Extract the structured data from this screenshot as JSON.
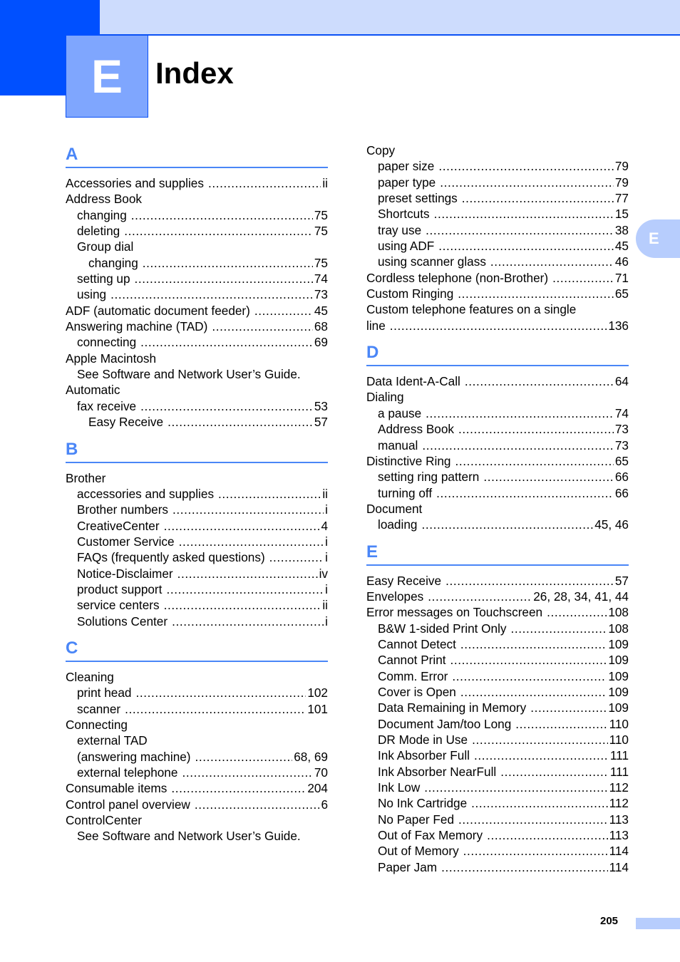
{
  "header": {
    "chapter_letter": "E",
    "title": "Index",
    "side_tab_letter": "E",
    "colors": {
      "accent": "#0050ff",
      "light_accent": "#7fa6fe",
      "band": "#cddcfd",
      "section_heading": "#4a86f7"
    }
  },
  "sections_left": [
    {
      "letter": "A",
      "entries": [
        {
          "term": "Accessories and supplies",
          "pages": "ii",
          "level": 0
        },
        {
          "term": "Address Book",
          "pages": "",
          "level": 0
        },
        {
          "term": "changing",
          "pages": "75",
          "level": 1
        },
        {
          "term": "deleting",
          "pages": "75",
          "level": 1
        },
        {
          "term": "Group dial",
          "pages": "",
          "level": 1
        },
        {
          "term": "changing",
          "pages": "75",
          "level": 2
        },
        {
          "term": "setting up",
          "pages": "74",
          "level": 1
        },
        {
          "term": "using",
          "pages": "73",
          "level": 1
        },
        {
          "term": "ADF (automatic document feeder)",
          "pages": "45",
          "level": 0
        },
        {
          "term": "Answering machine (TAD)",
          "pages": "68",
          "level": 0
        },
        {
          "term": "connecting",
          "pages": "69",
          "level": 1
        },
        {
          "term": "Apple Macintosh",
          "pages": "",
          "level": 0
        },
        {
          "term": "See Software and Network User’s Guide.",
          "pages": "",
          "level": 1
        },
        {
          "term": "Automatic",
          "pages": "",
          "level": 0
        },
        {
          "term": "fax receive",
          "pages": "53",
          "level": 1
        },
        {
          "term": "Easy Receive",
          "pages": "57",
          "level": 2
        }
      ]
    },
    {
      "letter": "B",
      "entries": [
        {
          "term": "Brother",
          "pages": "",
          "level": 0
        },
        {
          "term": "accessories and supplies",
          "pages": "ii",
          "level": 1
        },
        {
          "term": "Brother numbers",
          "pages": "i",
          "level": 1
        },
        {
          "term": "CreativeCenter",
          "pages": "4",
          "level": 1
        },
        {
          "term": "Customer Service",
          "pages": "i",
          "level": 1
        },
        {
          "term": "FAQs (frequently asked questions)",
          "pages": "i",
          "level": 1
        },
        {
          "term": "Notice-Disclaimer",
          "pages": "iv",
          "level": 1
        },
        {
          "term": "product support",
          "pages": "i",
          "level": 1
        },
        {
          "term": "service centers",
          "pages": "ii",
          "level": 1
        },
        {
          "term": "Solutions Center",
          "pages": "i",
          "level": 1
        }
      ]
    },
    {
      "letter": "C",
      "entries": [
        {
          "term": "Cleaning",
          "pages": "",
          "level": 0
        },
        {
          "term": "print head",
          "pages": "102",
          "level": 1
        },
        {
          "term": "scanner",
          "pages": "101",
          "level": 1
        },
        {
          "term": "Connecting",
          "pages": "",
          "level": 0
        },
        {
          "term": "external TAD",
          "pages": "",
          "level": 1
        },
        {
          "term": "(answering machine)",
          "pages": "68, 69",
          "level": 1
        },
        {
          "term": "external telephone",
          "pages": "70",
          "level": 1
        },
        {
          "term": "Consumable items",
          "pages": "204",
          "level": 0
        },
        {
          "term": "Control panel overview",
          "pages": "6",
          "level": 0
        },
        {
          "term": "ControlCenter",
          "pages": "",
          "level": 0
        },
        {
          "term": "See Software and Network User’s Guide.",
          "pages": "",
          "level": 1
        }
      ]
    }
  ],
  "sections_right": [
    {
      "letter": "",
      "entries": [
        {
          "term": "Copy",
          "pages": "",
          "level": 0
        },
        {
          "term": "paper size",
          "pages": "79",
          "level": 1
        },
        {
          "term": "paper type",
          "pages": "79",
          "level": 1
        },
        {
          "term": "preset settings",
          "pages": "77",
          "level": 1
        },
        {
          "term": "Shortcuts",
          "pages": "15",
          "level": 1
        },
        {
          "term": "tray use",
          "pages": "38",
          "level": 1
        },
        {
          "term": "using ADF",
          "pages": "45",
          "level": 1
        },
        {
          "term": "using scanner glass",
          "pages": "46",
          "level": 1
        },
        {
          "term": "Cordless telephone (non-Brother)",
          "pages": "71",
          "level": 0
        },
        {
          "term": "Custom Ringing",
          "pages": "65",
          "level": 0
        },
        {
          "term": "Custom telephone features on a single",
          "pages": "",
          "level": 0
        },
        {
          "term": "line",
          "pages": "136",
          "level": 0
        }
      ]
    },
    {
      "letter": "D",
      "entries": [
        {
          "term": "Data Ident-A-Call",
          "pages": "64",
          "level": 0
        },
        {
          "term": "Dialing",
          "pages": "",
          "level": 0
        },
        {
          "term": "a pause",
          "pages": "74",
          "level": 1
        },
        {
          "term": "Address Book",
          "pages": "73",
          "level": 1
        },
        {
          "term": "manual",
          "pages": "73",
          "level": 1
        },
        {
          "term": "Distinctive Ring",
          "pages": "65",
          "level": 0
        },
        {
          "term": "setting ring pattern",
          "pages": "66",
          "level": 1
        },
        {
          "term": "turning off",
          "pages": "66",
          "level": 1
        },
        {
          "term": "Document",
          "pages": "",
          "level": 0
        },
        {
          "term": "loading",
          "pages": "45, 46",
          "level": 1
        }
      ]
    },
    {
      "letter": "E",
      "entries": [
        {
          "term": "Easy Receive",
          "pages": "57",
          "level": 0
        },
        {
          "term": "Envelopes",
          "pages": "26, 28, 34, 41, 44",
          "level": 0
        },
        {
          "term": "Error messages on Touchscreen",
          "pages": "108",
          "level": 0
        },
        {
          "term": "B&W 1-sided Print Only",
          "pages": "108",
          "level": 1
        },
        {
          "term": "Cannot Detect",
          "pages": "109",
          "level": 1
        },
        {
          "term": "Cannot Print",
          "pages": "109",
          "level": 1
        },
        {
          "term": "Comm. Error",
          "pages": "109",
          "level": 1
        },
        {
          "term": "Cover is Open",
          "pages": "109",
          "level": 1
        },
        {
          "term": "Data Remaining in Memory",
          "pages": "109",
          "level": 1
        },
        {
          "term": "Document Jam/too Long",
          "pages": "110",
          "level": 1
        },
        {
          "term": "DR Mode in Use",
          "pages": "110",
          "level": 1
        },
        {
          "term": "Ink Absorber Full",
          "pages": "111",
          "level": 1
        },
        {
          "term": "Ink Absorber NearFull",
          "pages": "111",
          "level": 1
        },
        {
          "term": "Ink Low",
          "pages": "112",
          "level": 1
        },
        {
          "term": "No Ink Cartridge",
          "pages": "112",
          "level": 1
        },
        {
          "term": "No Paper Fed",
          "pages": "113",
          "level": 1
        },
        {
          "term": "Out of Fax Memory",
          "pages": "113",
          "level": 1
        },
        {
          "term": "Out of Memory",
          "pages": "114",
          "level": 1
        },
        {
          "term": "Paper Jam",
          "pages": "114",
          "level": 1
        }
      ]
    }
  ],
  "footer": {
    "page_number": "205"
  }
}
